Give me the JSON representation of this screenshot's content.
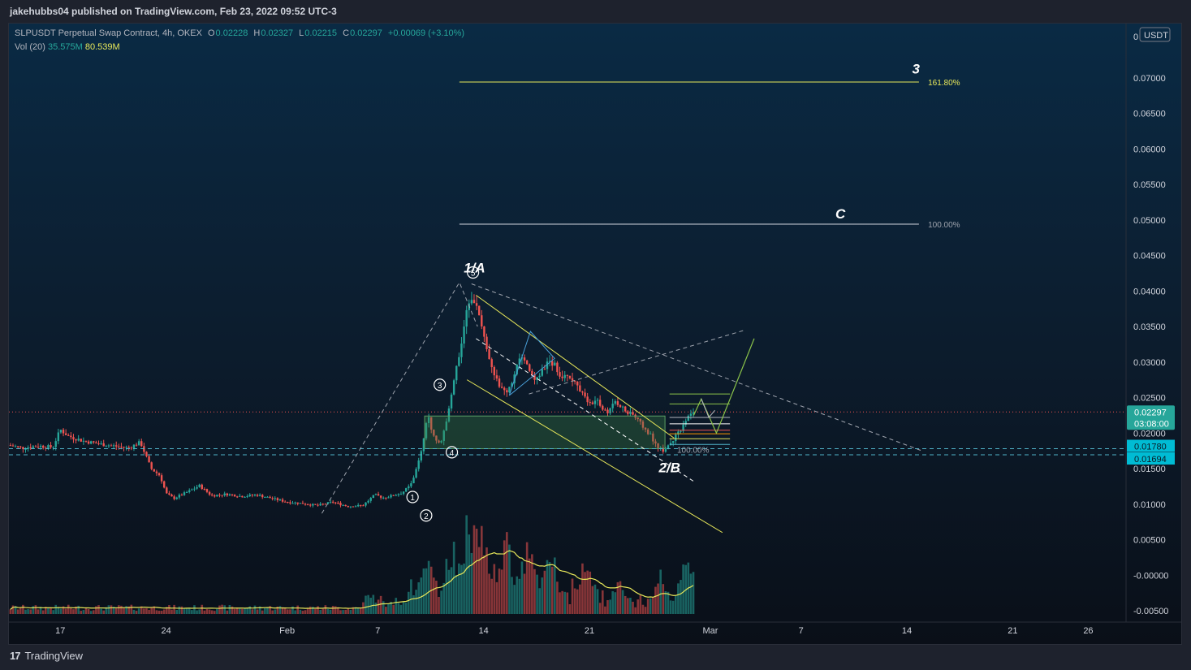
{
  "header": {
    "published_line": "jakehubbs04 published on TradingView.com, Feb 23, 2022 09:52 UTC-3"
  },
  "legend": {
    "symbol": "SLPUSDT Perpetual Swap Contract, 4h, OKEX",
    "o_label": "O",
    "o_value": "0.02228",
    "h_label": "H",
    "h_value": "0.02327",
    "l_label": "L",
    "l_value": "0.02215",
    "c_label": "C",
    "c_value": "0.02297",
    "change": "+0.00069 (+3.10%)",
    "vol_label": "Vol (20)",
    "vol_value": "35.575M",
    "vol_ma": "80.539M"
  },
  "footer": {
    "brand": "TradingView",
    "logo": "17"
  },
  "colors": {
    "up": "#26a69a",
    "down": "#ef5350",
    "fib": "#e8e85a",
    "accent": "#26a69a",
    "cyan": "#00bcd4"
  },
  "chart_data": {
    "type": "candlestick",
    "title": "",
    "xlabel": "",
    "ylabel": "",
    "currency": "USDT",
    "ylim": [
      -0.0066,
      0.0766
    ],
    "y_ticks": [
      "0",
      "0.07000",
      "0.06500",
      "0.06000",
      "0.05500",
      "0.05000",
      "0.04500",
      "0.04000",
      "0.03500",
      "0.03000",
      "0.02500",
      "0.02000",
      "0.01500",
      "0.01000",
      "0.00500",
      "-0.00000",
      "-0.00500"
    ],
    "y_tick_values": [
      0.0766,
      0.07,
      0.065,
      0.06,
      0.055,
      0.05,
      0.045,
      0.04,
      0.035,
      0.03,
      0.025,
      0.02,
      0.015,
      0.01,
      0.005,
      0.0,
      -0.005
    ],
    "x_ticks": [
      "17",
      "24",
      "Feb",
      "7",
      "14",
      "21",
      "Mar",
      "7",
      "14",
      "21",
      "26"
    ],
    "x_tick_days": [
      0,
      7,
      15,
      21,
      28,
      35,
      43,
      49,
      56,
      63,
      68
    ],
    "xlim_days": [
      -3.4,
      70.5
    ],
    "last_price": {
      "value": 0.02297,
      "label": "0.02297",
      "countdown": "03:08:00"
    },
    "price_labels": [
      {
        "value": 0.0178,
        "label": "0.01780"
      },
      {
        "value": 0.01694,
        "label": "0.01694"
      }
    ],
    "price_path": [
      [
        -3.4,
        0.0183
      ],
      [
        -2.5,
        0.0179
      ],
      [
        -1.5,
        0.0182
      ],
      [
        -0.5,
        0.018
      ],
      [
        0.0,
        0.0205
      ],
      [
        0.5,
        0.0196
      ],
      [
        1.5,
        0.0189
      ],
      [
        2.5,
        0.0185
      ],
      [
        3.5,
        0.0182
      ],
      [
        4.5,
        0.0179
      ],
      [
        5.3,
        0.0187
      ],
      [
        6.0,
        0.015
      ],
      [
        6.6,
        0.014
      ],
      [
        7.0,
        0.0115
      ],
      [
        7.5,
        0.0108
      ],
      [
        8.5,
        0.0118
      ],
      [
        9.2,
        0.0126
      ],
      [
        10.0,
        0.0112
      ],
      [
        11.0,
        0.0114
      ],
      [
        12.0,
        0.0111
      ],
      [
        13.0,
        0.0113
      ],
      [
        14.0,
        0.0108
      ],
      [
        15.0,
        0.0103
      ],
      [
        16.0,
        0.0101
      ],
      [
        17.0,
        0.0098
      ],
      [
        18.0,
        0.0103
      ],
      [
        19.0,
        0.0097
      ],
      [
        20.0,
        0.0098
      ],
      [
        20.8,
        0.0113
      ],
      [
        21.4,
        0.0109
      ],
      [
        22.0,
        0.0112
      ],
      [
        22.6,
        0.0116
      ],
      [
        23.1,
        0.0125
      ],
      [
        23.5,
        0.0145
      ],
      [
        23.9,
        0.0175
      ],
      [
        24.3,
        0.0225
      ],
      [
        24.7,
        0.0195
      ],
      [
        25.1,
        0.0185
      ],
      [
        25.5,
        0.021
      ],
      [
        25.9,
        0.026
      ],
      [
        26.3,
        0.03
      ],
      [
        26.7,
        0.035
      ],
      [
        27.1,
        0.0395
      ],
      [
        27.5,
        0.038
      ],
      [
        27.9,
        0.0345
      ],
      [
        28.3,
        0.0305
      ],
      [
        28.7,
        0.028
      ],
      [
        29.1,
        0.0265
      ],
      [
        29.5,
        0.0255
      ],
      [
        29.9,
        0.0275
      ],
      [
        30.3,
        0.0305
      ],
      [
        30.7,
        0.03
      ],
      [
        31.1,
        0.0285
      ],
      [
        31.5,
        0.0275
      ],
      [
        31.9,
        0.029
      ],
      [
        32.3,
        0.0302
      ],
      [
        32.7,
        0.0296
      ],
      [
        33.1,
        0.028
      ],
      [
        33.5,
        0.0285
      ],
      [
        33.9,
        0.0275
      ],
      [
        34.3,
        0.0263
      ],
      [
        34.7,
        0.0252
      ],
      [
        35.1,
        0.024
      ],
      [
        35.5,
        0.0245
      ],
      [
        35.9,
        0.0232
      ],
      [
        36.3,
        0.023
      ],
      [
        36.7,
        0.0245
      ],
      [
        37.1,
        0.0238
      ],
      [
        37.5,
        0.0228
      ],
      [
        37.9,
        0.0225
      ],
      [
        38.3,
        0.0215
      ],
      [
        38.7,
        0.0205
      ],
      [
        39.1,
        0.0195
      ],
      [
        39.5,
        0.018
      ],
      [
        39.9,
        0.0176
      ],
      [
        40.3,
        0.0185
      ],
      [
        40.7,
        0.0195
      ],
      [
        41.1,
        0.0205
      ],
      [
        41.5,
        0.0222
      ],
      [
        41.9,
        0.023
      ]
    ],
    "volume_peaks": [
      [
        24.3,
        0.3
      ],
      [
        26.0,
        0.47
      ],
      [
        26.9,
        0.55
      ],
      [
        27.2,
        0.6
      ],
      [
        27.6,
        0.65
      ],
      [
        28.3,
        0.4
      ],
      [
        29.5,
        0.5
      ],
      [
        30.9,
        0.44
      ],
      [
        32.5,
        0.36
      ],
      [
        34.8,
        0.28
      ],
      [
        37.0,
        0.2
      ],
      [
        39.7,
        0.24
      ],
      [
        41.4,
        0.36
      ],
      [
        41.9,
        0.34
      ]
    ],
    "fib_extension": [
      {
        "label": "161.80%",
        "value": 0.0694,
        "wave": "3"
      },
      {
        "label": "100.00%",
        "value": 0.0494,
        "wave": "C"
      },
      {
        "label": "100.00%",
        "value": 0.0178,
        "wave": ""
      }
    ],
    "wave_labels": [
      {
        "text": "1",
        "circled": true,
        "day": 23.3,
        "value": 0.011
      },
      {
        "text": "2",
        "circled": true,
        "day": 24.2,
        "value": 0.0084
      },
      {
        "text": "3",
        "circled": true,
        "day": 25.1,
        "value": 0.0268
      },
      {
        "text": "4",
        "circled": true,
        "day": 25.9,
        "value": 0.0173
      },
      {
        "text": "5",
        "circled": true,
        "day": 27.3,
        "value": 0.0426
      },
      {
        "text": "1/A",
        "circled": false,
        "day": 27.4,
        "value": 0.0426
      },
      {
        "text": "2/B",
        "circled": false,
        "day": 40.3,
        "value": 0.0145
      },
      {
        "text": "C",
        "circled": false,
        "day": 51.6,
        "value": 0.0502
      },
      {
        "text": "3",
        "circled": false,
        "day": 56.6,
        "value": 0.0706
      }
    ]
  }
}
